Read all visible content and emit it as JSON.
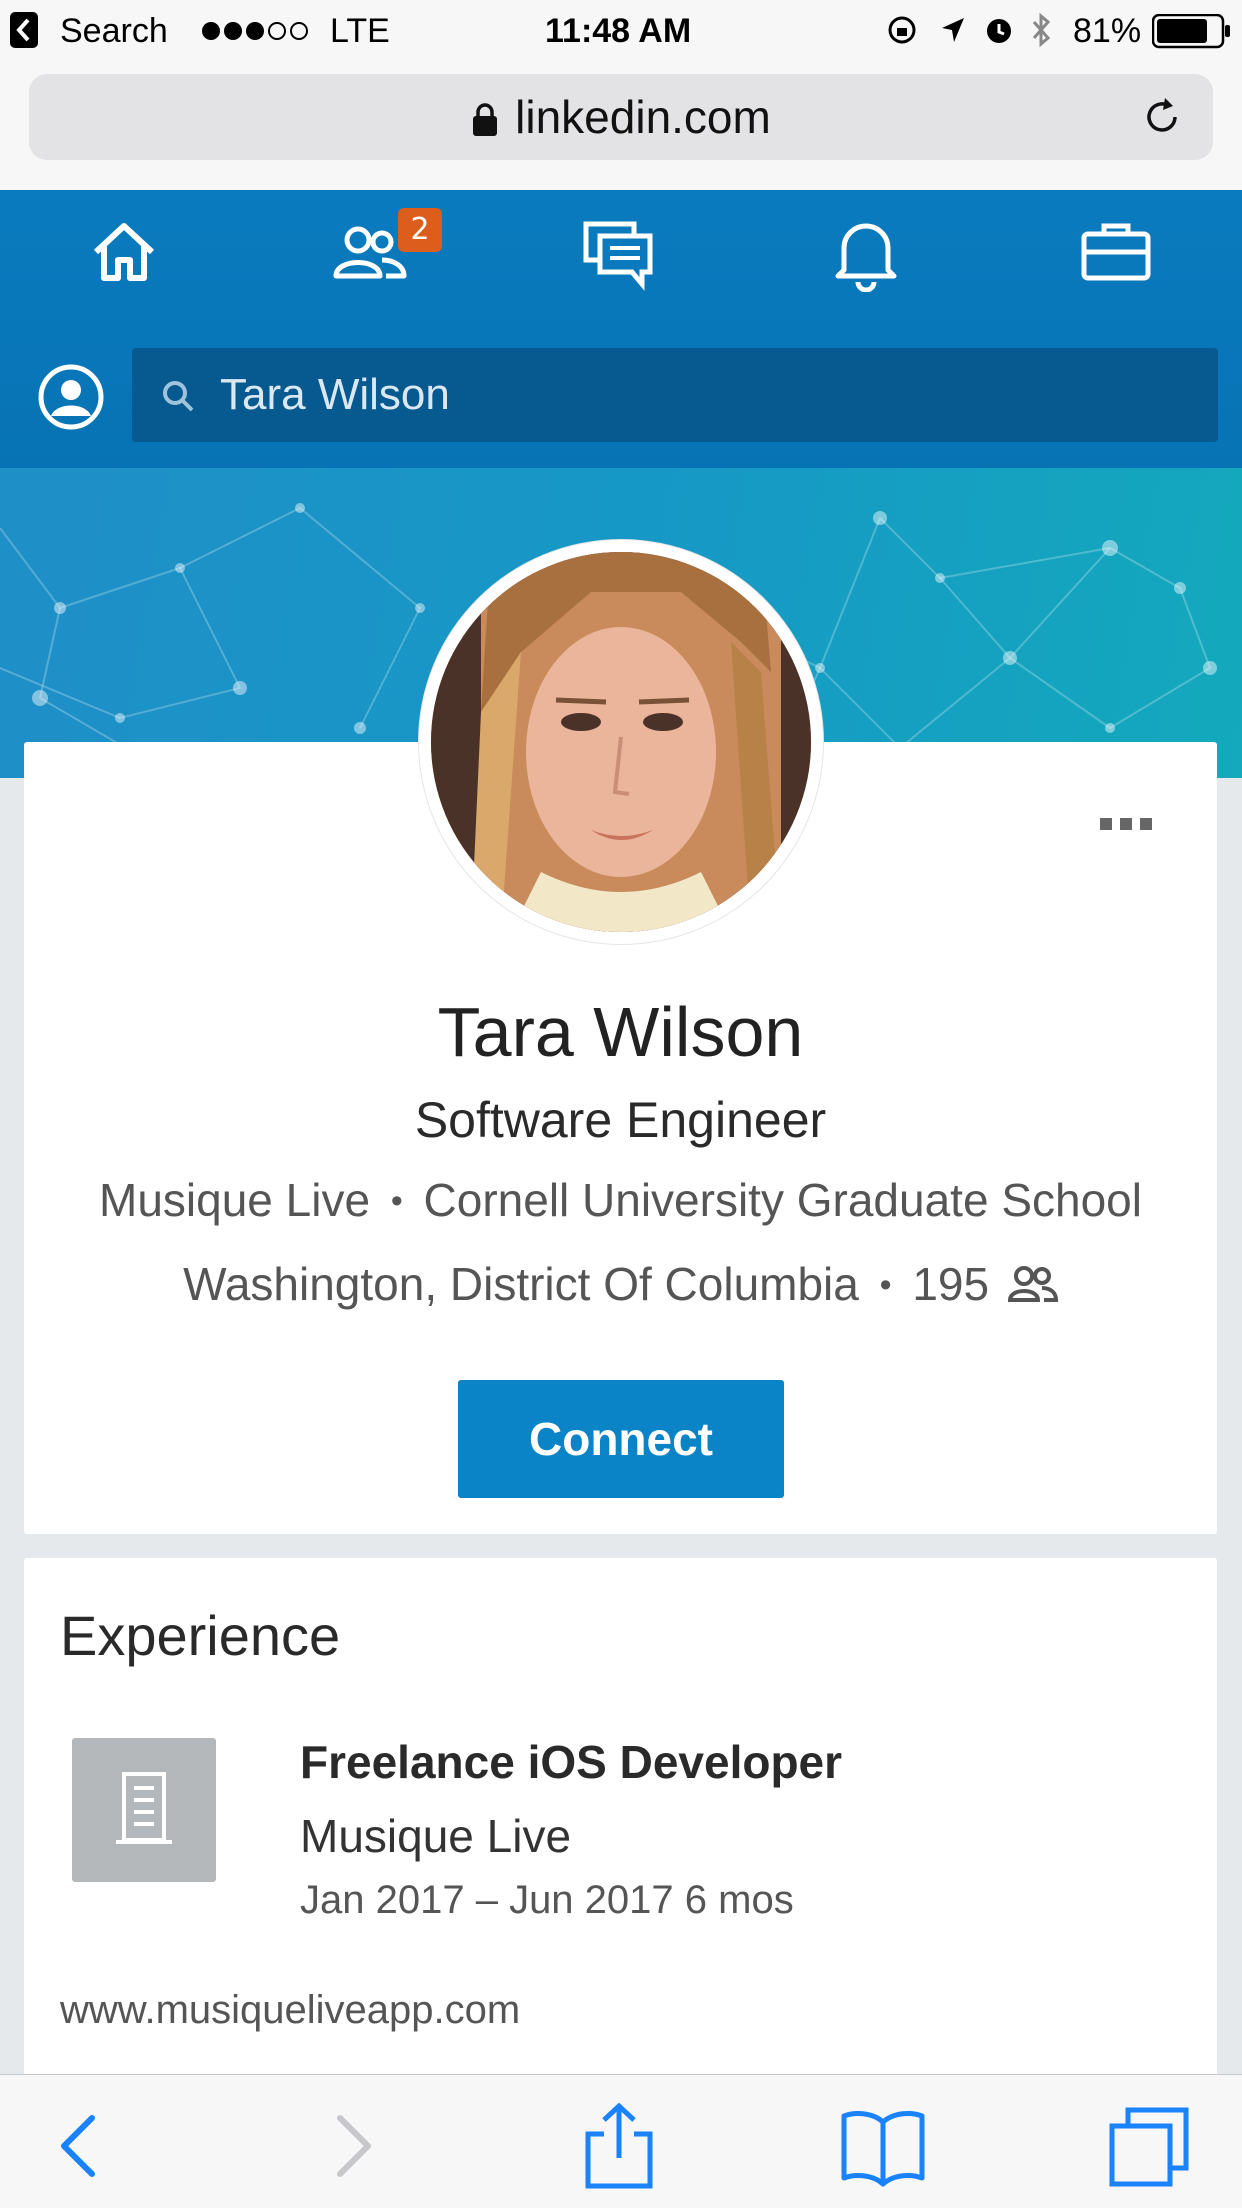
{
  "status_bar": {
    "back_label": "Search",
    "signal_filled": 3,
    "signal_total": 5,
    "network": "LTE",
    "time": "11:48 AM",
    "battery": "81%",
    "battery_level": 0.81
  },
  "browser": {
    "url": "linkedin.com"
  },
  "nav": {
    "items": [
      {
        "name": "home-icon"
      },
      {
        "name": "my-network-icon"
      },
      {
        "name": "messaging-icon"
      },
      {
        "name": "notifications-icon"
      },
      {
        "name": "jobs-icon"
      }
    ],
    "network_badge": "2"
  },
  "search": {
    "value": "Tara Wilson"
  },
  "profile": {
    "name": "Tara Wilson",
    "headline": "Software Engineer",
    "company": "Musique Live",
    "school": "Cornell University Graduate School",
    "location": "Washington, District Of Columbia",
    "connections": "195",
    "separator": "•",
    "connect_label": "Connect"
  },
  "experience": {
    "title": "Experience",
    "job_title": "Freelance iOS Developer",
    "company": "Musique Live",
    "dates": "Jan 2017 – Jun 2017 6 mos",
    "url": "www.musiqueliveapp.com"
  },
  "colors": {
    "brand_blue": "#0a84c6",
    "header_blue": "#0a7bbf",
    "badge_orange": "#dd5d1c",
    "safari_blue": "#1a82fb"
  }
}
